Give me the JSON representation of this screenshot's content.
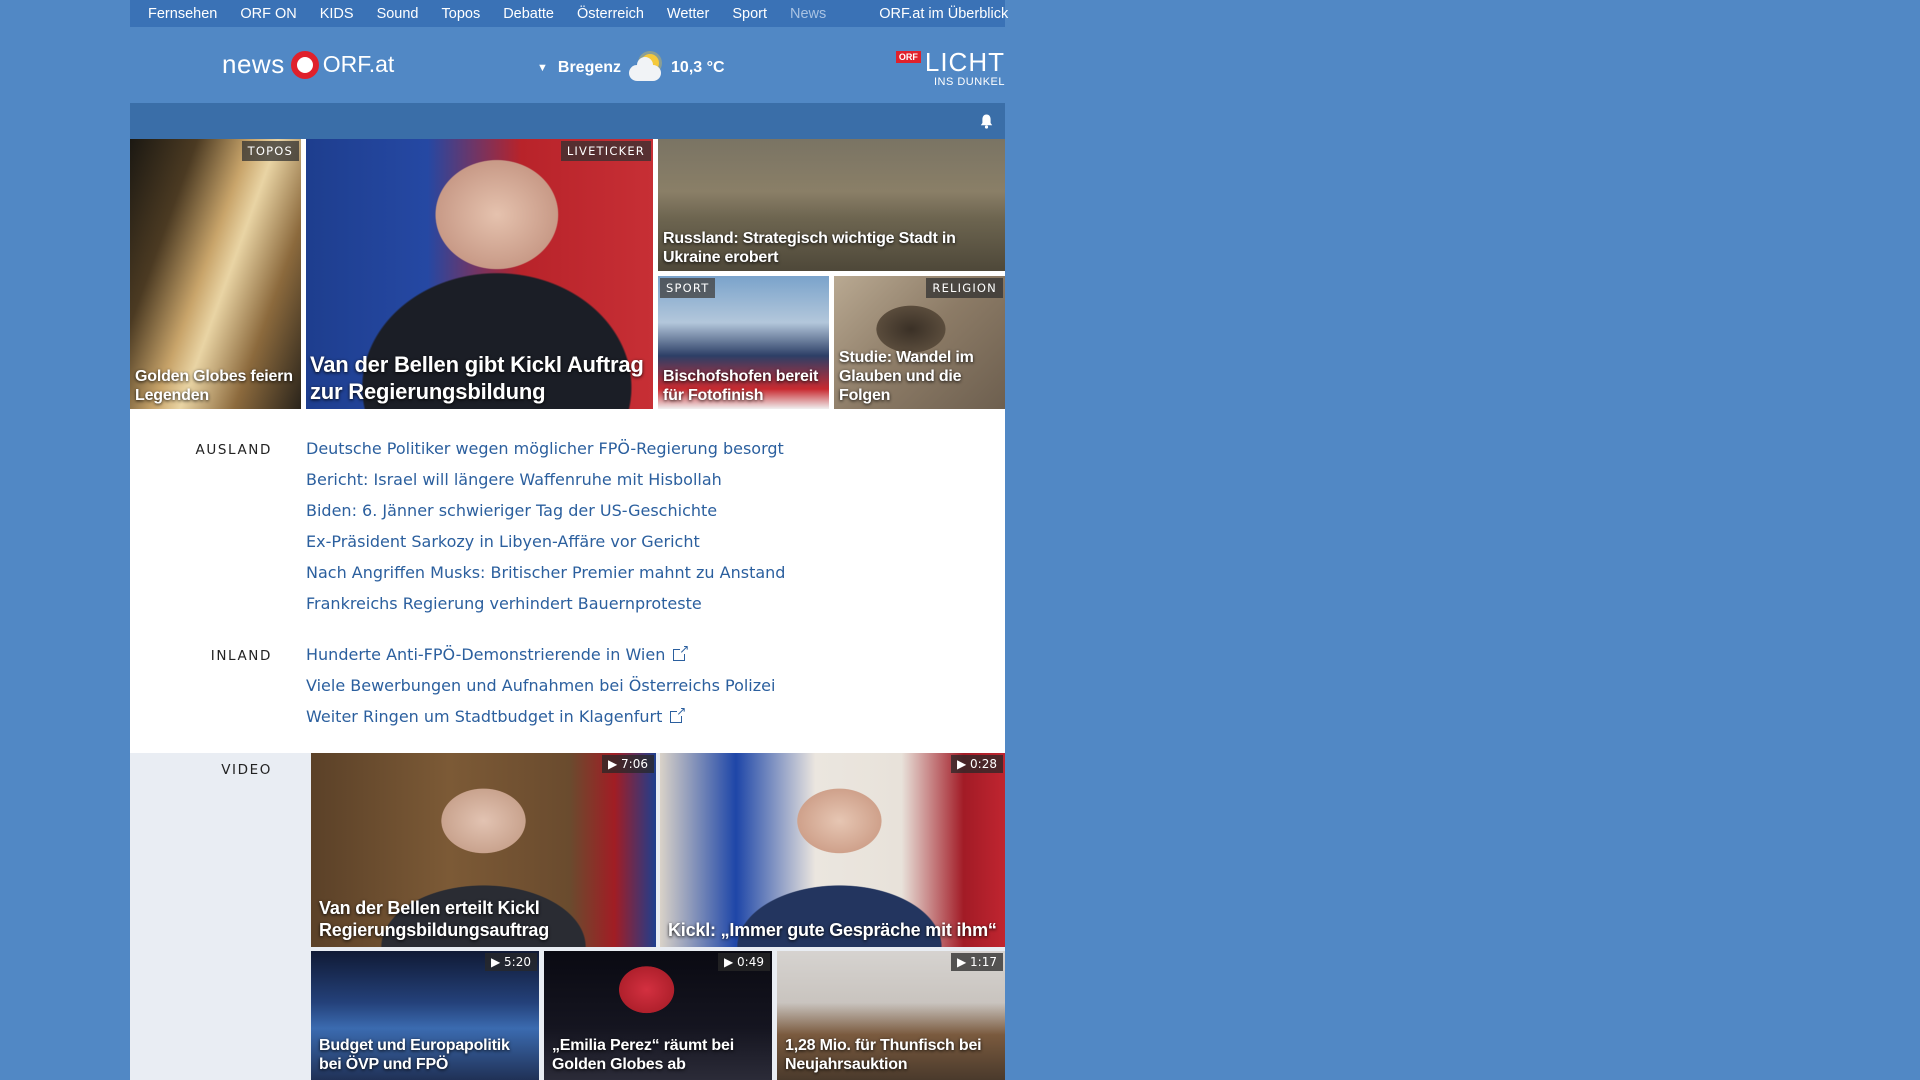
{
  "topnav": {
    "items": [
      "Fernsehen",
      "ORF ON",
      "KIDS",
      "Sound",
      "Topos",
      "Debatte",
      "Österreich",
      "Wetter",
      "Sport",
      "News"
    ],
    "active": "News",
    "overview": "ORF.at im Überblick"
  },
  "header": {
    "logo_news": "news",
    "logo_orf": "ORF.at",
    "weather_location": "Bregenz",
    "weather_temp": "10,3 °C",
    "weather_icon": "partly-cloudy-icon",
    "campaign_badge": "ORF",
    "campaign_title": "LICHT",
    "campaign_subtitle": "INS DUNKEL"
  },
  "teasers": [
    {
      "label": "TOPOS",
      "title": "Golden Globes feiern Legenden"
    },
    {
      "label": "LIVETICKER",
      "title": "Van der Bellen gibt Kickl Auftrag zur Regierungsbildung"
    },
    {
      "label": "",
      "title": "Russland: Strategisch wichtige Stadt in Ukraine erobert"
    },
    {
      "label": "SPORT",
      "title": "Bischofshofen bereit für Fotofinish"
    },
    {
      "label": "RELIGION",
      "title": "Studie: Wandel im Glauben und die Folgen"
    }
  ],
  "sections": {
    "ausland": {
      "label": "AUSLAND",
      "items": [
        "Deutsche Politiker wegen möglicher FPÖ-Regierung besorgt",
        "Bericht: Israel will längere Waffenruhe mit Hisbollah",
        "Biden: 6. Jänner schwieriger Tag der US-Geschichte",
        "Ex-Präsident Sarkozy in Libyen-Affäre vor Gericht",
        "Nach Angriffen Musks: Britischer Premier mahnt zu Anstand",
        "Frankreichs Regierung verhindert Bauernproteste"
      ]
    },
    "inland": {
      "label": "INLAND",
      "items": [
        "Hunderte Anti-FPÖ-Demonstrierende in Wien",
        "Viele Bewerbungen und Aufnahmen bei Österreichs Polizei",
        "Weiter Ringen um Stadtbudget in Klagenfurt"
      ]
    },
    "video": {
      "label": "VIDEO",
      "items": [
        {
          "duration": "7:06",
          "title": "Van der Bellen erteilt Kickl Regierungsbildungsauftrag"
        },
        {
          "duration": "0:28",
          "title": "Kickl: „Immer gute Gespräche mit ihm“"
        },
        {
          "duration": "5:20",
          "title": "Budget und Europapolitik bei ÖVP und FPÖ"
        },
        {
          "duration": "0:49",
          "title": "„Emilia Perez“ räumt bei Golden Globes ab"
        },
        {
          "duration": "1:17",
          "title": "1,28 Mio. für Thunfisch bei Neujahrsauktion"
        }
      ]
    }
  },
  "colors": {
    "background": "#5188c5",
    "nav": "#3a72b6",
    "link": "#2b5f9e",
    "accent": "#e0202b"
  }
}
